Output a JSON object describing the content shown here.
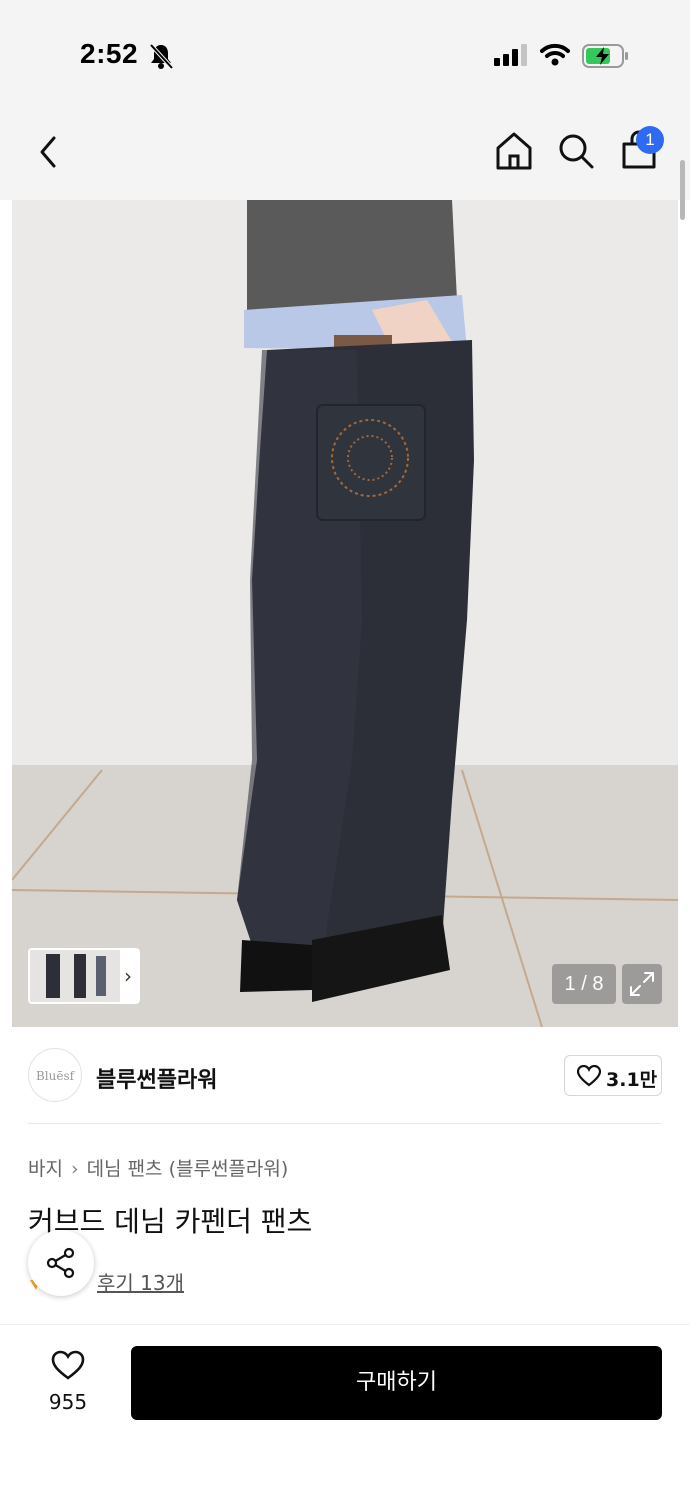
{
  "status_bar": {
    "time": "2:52",
    "icons": [
      "bell-slash-icon",
      "signal-icon",
      "wifi-icon",
      "battery-charging-icon"
    ]
  },
  "nav": {
    "icons": [
      "back-icon",
      "home-icon",
      "search-icon",
      "shopping-bag-icon"
    ],
    "cart_count": "1"
  },
  "gallery": {
    "page_indicator": "1 / 8",
    "icons": [
      "chevron-right-icon",
      "expand-icon"
    ]
  },
  "brand": {
    "logo_text": "Bluēsf",
    "name": "블루썬플라워",
    "like_count": "3.1만"
  },
  "product": {
    "breadcrumb": [
      "바지",
      "데님 팬츠 (블루썬플라워)"
    ],
    "title": "커브드 데님 카펜더 팬츠",
    "review_link": "후기 13개"
  },
  "bottom": {
    "wish_count": "955",
    "buy_label": "구매하기"
  },
  "colors": {
    "badge": "#2f6bf2",
    "buy_button": "#000000",
    "top_background": "#f4f4f4"
  }
}
